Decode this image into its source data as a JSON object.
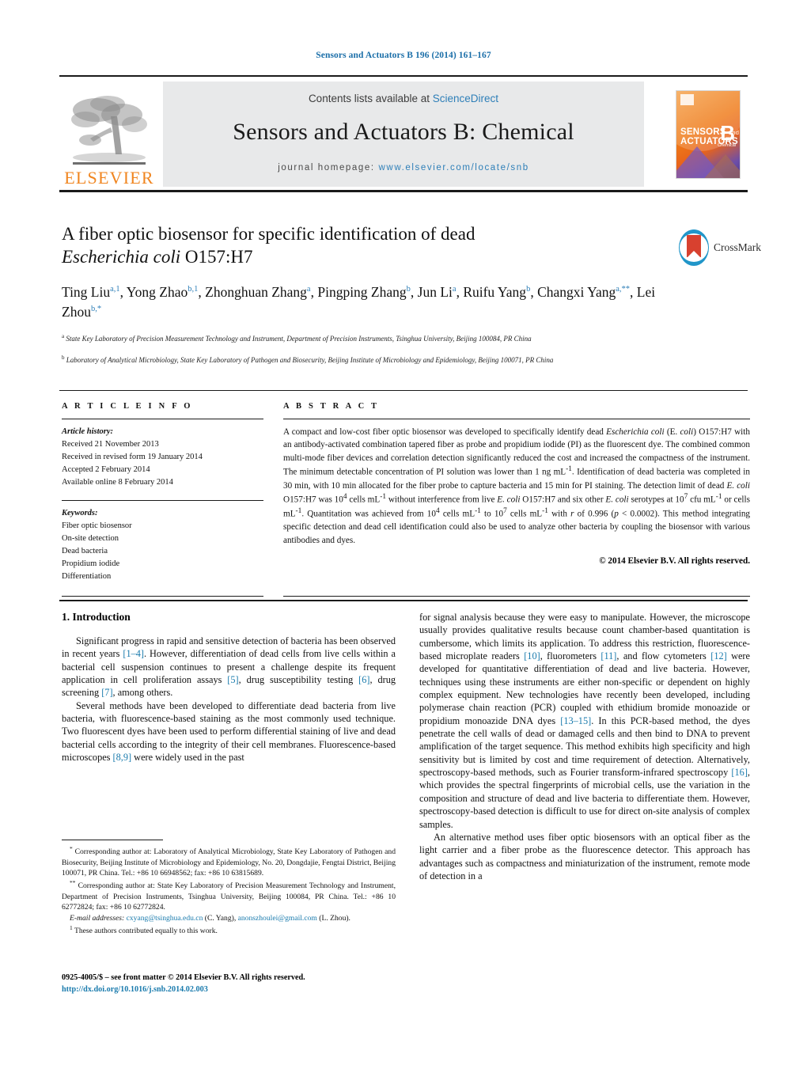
{
  "running_head": "Sensors and Actuators B 196 (2014) 161–167",
  "masthead": {
    "contents_prefix": "Contents lists available at ",
    "contents_link": "ScienceDirect",
    "journal_title": "Sensors and Actuators B: Chemical",
    "homepage_label": "journal homepage: ",
    "homepage_link": "www.elsevier.com/locate/snb",
    "publisher_logo_text": "ELSEVIER",
    "publisher_logo_icon": "elsevier-tree-icon",
    "cover_line1": "SENSORS",
    "cover_line1_small": "and",
    "cover_line2": "ACTUATORS",
    "cover_letter": "B",
    "cover_letter_sub": "Chemical"
  },
  "article": {
    "title_line1": "A fiber optic biosensor for specific identification of dead",
    "title_line2_italic": "Escherichia coli",
    "title_line2_rest": " O157:H7",
    "crossmark_label": "CrossMark",
    "authors_html": "Ting Liu<sup>a,1</sup>, Yong Zhao<sup>b,1</sup>, Zhonghuan Zhang<sup>a</sup>, Pingping Zhang<sup>b</sup>, Jun Li<sup>a</sup>, Ruifu Yang<sup>b</sup>, Changxi Yang<sup>a,**</sup>, Lei Zhou<sup>b,*</sup>",
    "affiliation_a": "State Key Laboratory of Precision Measurement Technology and Instrument, Department of Precision Instruments, Tsinghua University, Beijing 100084, PR China",
    "affiliation_b": "Laboratory of Analytical Microbiology, State Key Laboratory of Pathogen and Biosecurity, Beijing Institute of Microbiology and Epidemiology, Beijing 100071, PR China"
  },
  "article_info": {
    "heading": "A R T I C L E   I N F O",
    "history_label": "Article history:",
    "history": [
      "Received 21 November 2013",
      "Received in revised form 19 January 2014",
      "Accepted 2 February 2014",
      "Available online 8 February 2014"
    ],
    "keywords_label": "Keywords:",
    "keywords": [
      "Fiber optic biosensor",
      "On-site detection",
      "Dead bacteria",
      "Propidium iodide",
      "Differentiation"
    ]
  },
  "abstract": {
    "heading": "A B S T R A C T",
    "text_html": "A compact and low-cost fiber optic biosensor was developed to specifically identify dead <i>Escherichia coli</i> (E. <i>coli</i>) O157:H7 with an antibody-activated combination tapered fiber as probe and propidium iodide (PI) as the fluorescent dye. The combined common multi-mode fiber devices and correlation detection significantly reduced the cost and increased the compactness of the instrument. The minimum detectable concentration of PI solution was lower than 1 ng mL<sup>-1</sup>. Identification of dead bacteria was completed in 30 min, with 10 min allocated for the fiber probe to capture bacteria and 15 min for PI staining. The detection limit of dead <i>E. coli</i> O157:H7 was 10<sup>4</sup> cells mL<sup>-1</sup> without interference from live <i>E. coli</i> O157:H7 and six other <i>E. coli</i> serotypes at 10<sup>7</sup> cfu mL<sup>-1</sup> or cells mL<sup>-1</sup>. Quantitation was achieved from 10<sup>4</sup> cells mL<sup>-1</sup> to 10<sup>7</sup> cells mL<sup>-1</sup> with <i>r</i> of 0.996 (<i>p</i> &lt; 0.0002). This method integrating specific detection and dead cell identification could also be used to analyze other bacteria by coupling the biosensor with various antibodies and dyes.",
    "copyright": "© 2014 Elsevier B.V. All rights reserved."
  },
  "body": {
    "section_heading": "1.  Introduction",
    "left_paragraph_1_html": "Significant progress in rapid and sensitive detection of bacteria has been observed in recent years <a class=\"ref\" href=\"#\">[1–4]</a>. However, differentiation of dead cells from live cells within a bacterial cell suspension continues to present a challenge despite its frequent application in cell proliferation assays <a class=\"ref\" href=\"#\">[5]</a>, drug susceptibility testing <a class=\"ref\" href=\"#\">[6]</a>, drug screening <a class=\"ref\" href=\"#\">[7]</a>, among others.",
    "left_paragraph_2_html": "Several methods have been developed to differentiate dead bacteria from live bacteria, with fluorescence-based staining as the most commonly used technique. Two fluorescent dyes have been used to perform differential staining of live and dead bacterial cells according to the integrity of their cell membranes. Fluorescence-based microscopes <a class=\"ref\" href=\"#\">[8,9]</a> were widely used in the past",
    "right_paragraph_1_html": "for signal analysis because they were easy to manipulate. However, the microscope usually provides qualitative results because count chamber-based quantitation is cumbersome, which limits its application. To address this restriction, fluorescence-based microplate readers <a class=\"ref\" href=\"#\">[10]</a>, fluorometers <a class=\"ref\" href=\"#\">[11]</a>, and flow cytometers <a class=\"ref\" href=\"#\">[12]</a> were developed for quantitative differentiation of dead and live bacteria. However, techniques using these instruments are either non-specific or dependent on highly complex equipment. New technologies have recently been developed, including polymerase chain reaction (PCR) coupled with ethidium bromide monoazide or propidium monoazide DNA dyes <a class=\"ref\" href=\"#\">[13–15]</a>. In this PCR-based method, the dyes penetrate the cell walls of dead or damaged cells and then bind to DNA to prevent amplification of the target sequence. This method exhibits high specificity and high sensitivity but is limited by cost and time requirement of detection. Alternatively, spectroscopy-based methods, such as Fourier transform-infrared spectroscopy <a class=\"ref\" href=\"#\">[16]</a>, which provides the spectral fingerprints of microbial cells, use the variation in the composition and structure of dead and live bacteria to differentiate them. However, spectroscopy-based detection is difficult to use for direct on-site analysis of complex samples.",
    "right_paragraph_2_html": "An alternative method uses fiber optic biosensors with an optical fiber as the light carrier and a fiber probe as the fluorescence detector. This approach has advantages such as compactness and miniaturization of the instrument, remote mode of detection in a"
  },
  "footnotes": {
    "note_star_html": "<sup>*</sup>  Corresponding author at: Laboratory of Analytical Microbiology, State Key Laboratory of Pathogen and Biosecurity, Beijing Institute of Microbiology and Epidemiology, No. 20, Dongdajie, Fengtai District, Beijing 100071, PR China. Tel.: +86 10 66948562; fax: +86 10 63815689.",
    "note_doublestar_html": "<sup>**</sup> Corresponding author at: State Key Laboratory of Precision Measurement Technology and Instrument, Department of Precision Instruments, Tsinghua University, Beijing 100084, PR China. Tel.: +86 10 62772824; fax: +86 10 62772824.",
    "emails_html": "<i>E-mail addresses:</i> <a href=\"#\">cxyang@tsinghua.edu.cn</a> (C. Yang), <a href=\"#\">anonszhoulei@gmail.com</a> (L. Zhou).",
    "note_1_html": "<sup>1</sup>  These authors contributed equally to this work.",
    "issn_line": "0925-4005/$ – see front matter © 2014 Elsevier B.V. All rights reserved.",
    "doi_link": "http://dx.doi.org/10.1016/j.snb.2014.02.003"
  },
  "colors": {
    "link_blue": "#1a7bad",
    "masthead_link": "#2e7fb8",
    "elsevier_orange": "#f0851f",
    "banner_gray": "#e8e9ea"
  }
}
